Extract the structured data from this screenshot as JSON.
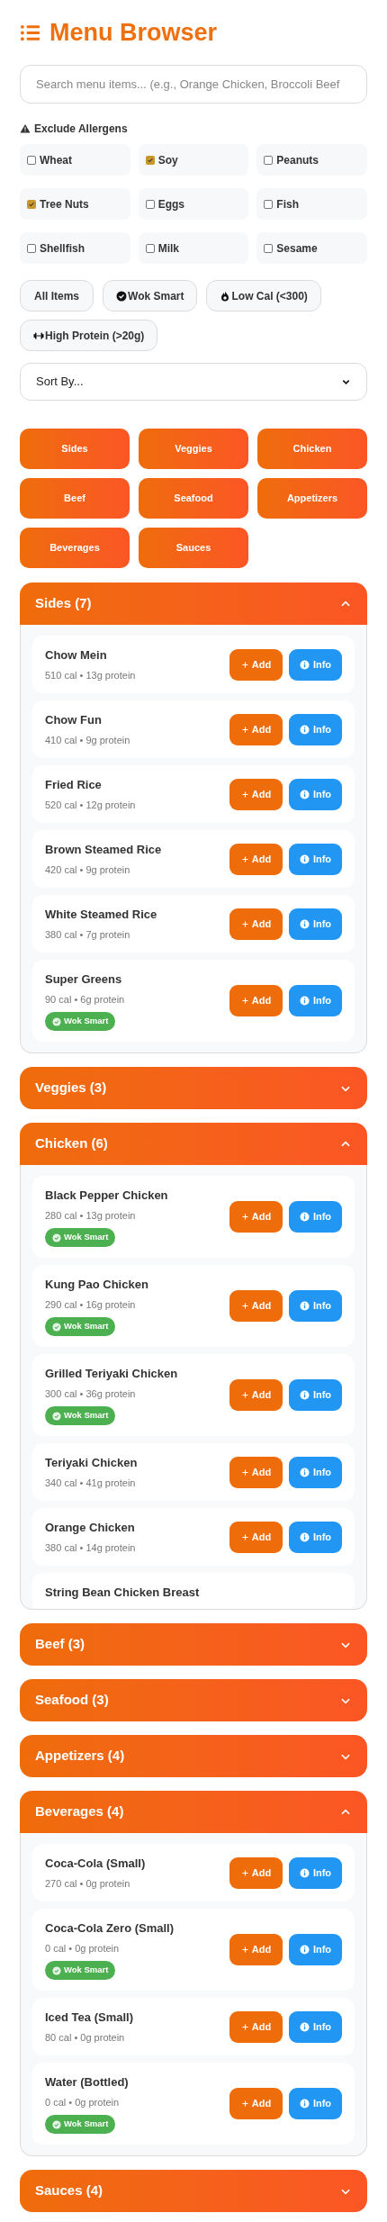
{
  "title": "Menu Browser",
  "search": {
    "placeholder": "Search menu items... (e.g., Orange Chicken, Broccoli Beef"
  },
  "allergens": {
    "heading": "Exclude Allergens",
    "items": [
      {
        "label": "Wheat",
        "checked": false
      },
      {
        "label": "Soy",
        "checked": true
      },
      {
        "label": "Peanuts",
        "checked": false
      },
      {
        "label": "Tree Nuts",
        "checked": true
      },
      {
        "label": "Eggs",
        "checked": false
      },
      {
        "label": "Fish",
        "checked": false
      },
      {
        "label": "Shellfish",
        "checked": false
      },
      {
        "label": "Milk",
        "checked": false
      },
      {
        "label": "Sesame",
        "checked": false
      }
    ]
  },
  "filters": [
    {
      "label": "All Items",
      "kind": "plain"
    },
    {
      "label": "Wok Smart",
      "kind": "check"
    },
    {
      "label": "Low Cal (<300)",
      "kind": "flame"
    },
    {
      "label": "High Protein (>20g)",
      "kind": "dumbbell"
    }
  ],
  "sort": {
    "value": "Sort By..."
  },
  "categories": [
    "Sides",
    "Veggies",
    "Chicken",
    "Beef",
    "Seafood",
    "Appetizers",
    "Beverages",
    "Sauces"
  ],
  "sections": [
    {
      "title": "Sides (7)",
      "expanded": true,
      "items": [
        {
          "name": "Chow Mein",
          "nutrition": "510 cal • 13g protein",
          "add": "Add",
          "info": "Info"
        },
        {
          "name": "Chow Fun",
          "nutrition": "410 cal • 9g protein",
          "add": "Add",
          "info": "Info"
        },
        {
          "name": "Fried Rice",
          "nutrition": "520 cal • 12g protein",
          "add": "Add",
          "info": "Info"
        },
        {
          "name": "Brown Steamed Rice",
          "nutrition": "420 cal • 9g protein",
          "add": "Add",
          "info": "Info"
        },
        {
          "name": "White Steamed Rice",
          "nutrition": "380 cal • 7g protein",
          "add": "Add",
          "info": "Info"
        },
        {
          "name": "Super Greens",
          "nutrition": "90 cal • 6g protein",
          "badge": "Wok Smart",
          "add": "Add",
          "info": "Info"
        }
      ]
    },
    {
      "title": "Veggies (3)",
      "expanded": false
    },
    {
      "title": "Chicken (6)",
      "expanded": true,
      "items": [
        {
          "name": "Black Pepper Chicken",
          "nutrition": "280 cal • 13g protein",
          "badge": "Wok Smart",
          "add": "Add",
          "info": "Info"
        },
        {
          "name": "Kung Pao Chicken",
          "nutrition": "290 cal • 16g protein",
          "badge": "Wok Smart",
          "add": "Add",
          "info": "Info"
        },
        {
          "name": "Grilled Teriyaki Chicken",
          "nutrition": "300 cal • 36g protein",
          "badge": "Wok Smart",
          "add": "Add",
          "info": "Info"
        },
        {
          "name": "Teriyaki Chicken",
          "nutrition": "340 cal • 41g protein",
          "add": "Add",
          "info": "Info"
        },
        {
          "name": "Orange Chicken",
          "nutrition": "380 cal • 14g protein",
          "add": "Add",
          "info": "Info"
        },
        {
          "name": "String Bean Chicken Breast"
        }
      ]
    },
    {
      "title": "Beef (3)",
      "expanded": false
    },
    {
      "title": "Seafood (3)",
      "expanded": false
    },
    {
      "title": "Appetizers (4)",
      "expanded": false
    },
    {
      "title": "Beverages (4)",
      "expanded": true,
      "items": [
        {
          "name": "Coca-Cola (Small)",
          "nutrition": "270 cal • 0g protein",
          "add": "Add",
          "info": "Info"
        },
        {
          "name": "Coca-Cola Zero (Small)",
          "nutrition": "0 cal • 0g protein",
          "badge": "Wok Smart",
          "add": "Add",
          "info": "Info"
        },
        {
          "name": "Iced Tea (Small)",
          "nutrition": "80 cal • 0g protein",
          "add": "Add",
          "info": "Info"
        },
        {
          "name": "Water (Bottled)",
          "nutrition": "0 cal • 0g protein",
          "badge": "Wok Smart",
          "add": "Add",
          "info": "Info"
        }
      ]
    },
    {
      "title": "Sauces (4)",
      "expanded": false
    }
  ]
}
